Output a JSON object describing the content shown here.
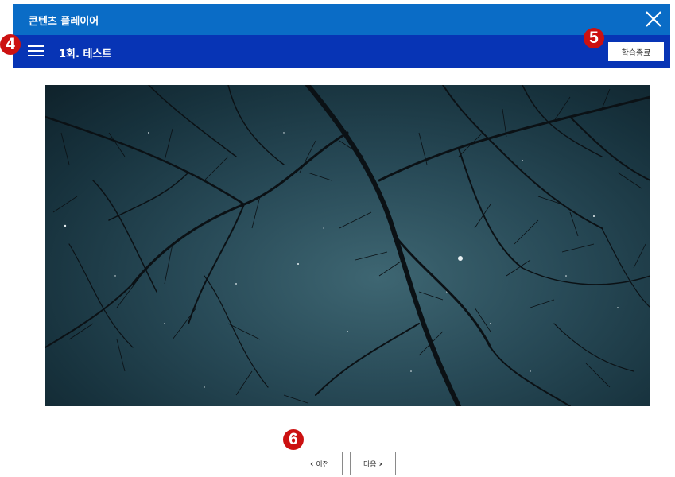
{
  "window": {
    "title": "콘텐츠 플레이어",
    "close_icon": "close-icon"
  },
  "header": {
    "menu_icon": "hamburger-menu-icon",
    "lesson_title": "1회. 테스트",
    "end_button_label": "학습종료"
  },
  "badges": {
    "menu": "4",
    "end": "5",
    "nav": "6"
  },
  "content": {
    "image_subject": "night sky with bare tree branches and stars"
  },
  "navigation": {
    "prev_label": "이전",
    "next_label": "다음",
    "prev_icon": "chevron-left-icon",
    "next_icon": "chevron-right-icon"
  },
  "colors": {
    "titlebar": "#0a6cc6",
    "subbar": "#0734b5",
    "badge": "#cc1111"
  }
}
